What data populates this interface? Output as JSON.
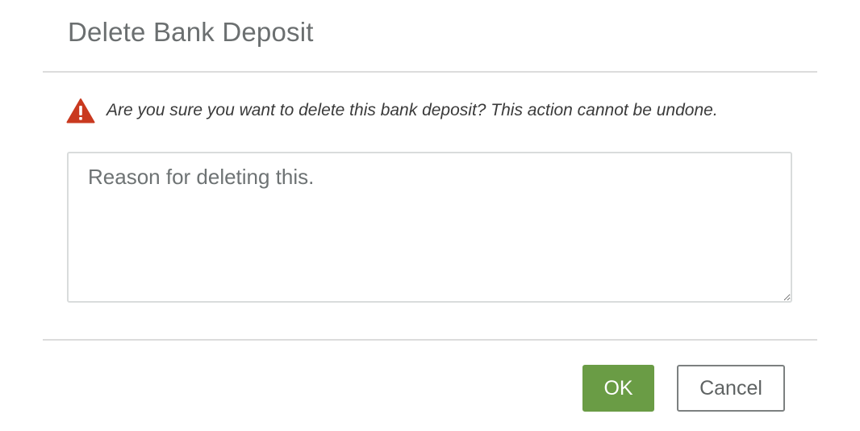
{
  "dialog": {
    "title": "Delete Bank Deposit",
    "warning_icon": "warning-triangle-icon",
    "warning_color": "#c9391f",
    "warning_text": "Are you sure you want to delete this bank deposit? This action cannot be undone.",
    "reason": {
      "value": "",
      "placeholder": "Reason for deleting this."
    },
    "buttons": {
      "ok_label": "OK",
      "cancel_label": "Cancel"
    },
    "colors": {
      "ok_button": "#6a9c45",
      "title_text": "#6b6f70"
    }
  }
}
